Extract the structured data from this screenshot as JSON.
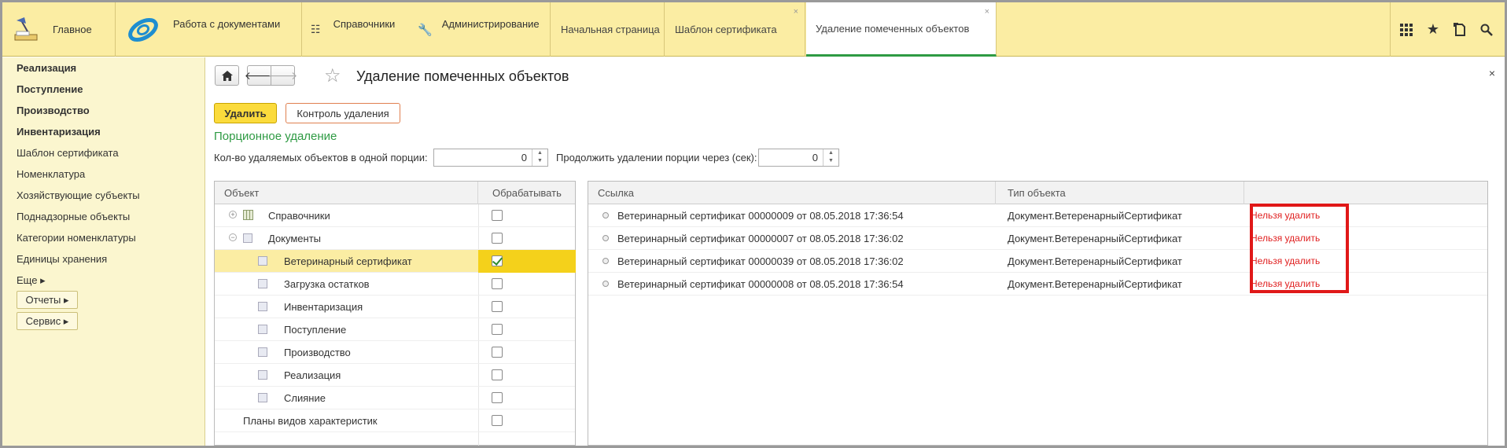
{
  "topbar": {
    "sections": [
      {
        "label": "Главное",
        "icon": "home-desk-icon"
      },
      {
        "label": "Работа с документами",
        "icon": "orbit-logo-icon"
      },
      {
        "label": "Справочники",
        "icon": "list-icon"
      },
      {
        "label": "Администрирование",
        "icon": "wrench-icon"
      }
    ],
    "tabs": [
      {
        "label": "Начальная страница",
        "closable": false
      },
      {
        "label": "Шаблон сертификата",
        "closable": true
      },
      {
        "label": "Удаление помеченных объектов",
        "closable": true,
        "active": true
      }
    ],
    "close_glyph": "×",
    "right_icons": [
      "apps-grid-icon",
      "star-icon",
      "history-icon",
      "search-icon"
    ]
  },
  "sidebar": {
    "items": [
      {
        "label": "Реализация",
        "bold": true
      },
      {
        "label": "Поступление",
        "bold": true
      },
      {
        "label": "Производство",
        "bold": true
      },
      {
        "label": "Инвентаризация",
        "bold": true
      },
      {
        "label": "Шаблон сертификата",
        "bold": false
      },
      {
        "label": "Номенклатура",
        "bold": false
      },
      {
        "label": "Хозяйствующие субъекты",
        "bold": false
      },
      {
        "label": "Поднадзорные объекты",
        "bold": false
      },
      {
        "label": "Категории номенклатуры",
        "bold": false
      },
      {
        "label": "Единицы хранения",
        "bold": false
      },
      {
        "label": "Еще ▸",
        "bold": false
      }
    ],
    "buttons": [
      {
        "label": "Отчеты ▸"
      },
      {
        "label": "Сервис ▸"
      }
    ]
  },
  "main": {
    "title": "Удаление помеченных объектов",
    "close_glyph": "×",
    "delete_label": "Удалить",
    "control_label": "Контроль удаления",
    "group_title": "Порционное удаление",
    "portion_label": "Кол-во удаляемых объектов в одной порции:",
    "portion_value": "0",
    "continue_label": "Продолжить удалении порции через (сек):",
    "continue_value": "0"
  },
  "left_table": {
    "headers": [
      "Объект",
      "Обрабатывать"
    ],
    "rows": [
      {
        "label": "Справочники",
        "level": 0,
        "expander": "+",
        "icon": "grid-icon",
        "checked": false
      },
      {
        "label": "Документы",
        "level": 0,
        "expander": "−",
        "icon": "doc-icon",
        "checked": false
      },
      {
        "label": "Ветеринарный сертификат",
        "level": 1,
        "icon": "doc-icon",
        "checked": true,
        "selected": true
      },
      {
        "label": "Загрузка остатков",
        "level": 1,
        "icon": "doc-icon",
        "checked": false
      },
      {
        "label": "Инвентаризация",
        "level": 1,
        "icon": "doc-icon",
        "checked": false
      },
      {
        "label": "Поступление",
        "level": 1,
        "icon": "doc-icon",
        "checked": false
      },
      {
        "label": "Производство",
        "level": 1,
        "icon": "doc-icon",
        "checked": false
      },
      {
        "label": "Реализация",
        "level": 1,
        "icon": "doc-icon",
        "checked": false
      },
      {
        "label": "Слияние",
        "level": 1,
        "icon": "doc-icon",
        "checked": false
      },
      {
        "label": "Планы видов характеристик",
        "level": -1,
        "checked": false
      }
    ]
  },
  "right_table": {
    "headers": [
      "Ссылка",
      "Тип объекта",
      ""
    ],
    "rows": [
      {
        "link": "Ветеринарный сертификат 00000009 от 08.05.2018 17:36:54",
        "type": "Документ.ВетеренарныйСертификат",
        "status": "Нельзя удалить"
      },
      {
        "link": "Ветеринарный сертификат 00000007 от 08.05.2018 17:36:02",
        "type": "Документ.ВетеренарныйСертификат",
        "status": "Нельзя удалить"
      },
      {
        "link": "Ветеринарный сертификат 00000039 от 08.05.2018 17:36:02",
        "type": "Документ.ВетеренарныйСертификат",
        "status": "Нельзя удалить"
      },
      {
        "link": "Ветеринарный сертификат 00000008 от 08.05.2018 17:36:54",
        "type": "Документ.ВетеренарныйСертификат",
        "status": "Нельзя удалить"
      }
    ]
  },
  "colors": {
    "accent_yellow": "#fbeda3",
    "button_yellow": "#fbdb3c",
    "green": "#2e9a43",
    "error_red": "#e02020"
  }
}
